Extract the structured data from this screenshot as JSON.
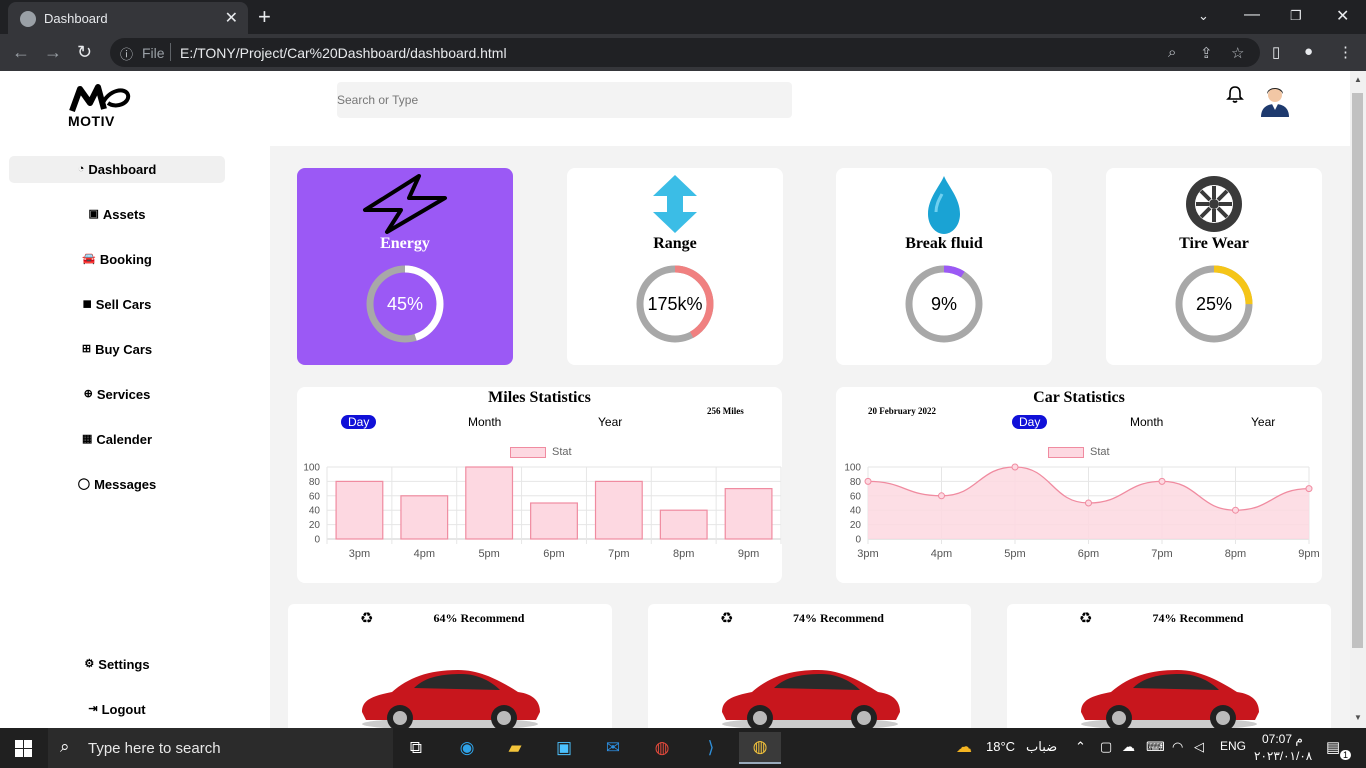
{
  "browser": {
    "tab_title": "Dashboard",
    "file_label": "File",
    "url": "E:/TONY/Project/Car%20Dashboard/dashboard.html"
  },
  "header": {
    "logo_text": "MOTIV",
    "search_placeholder": "Search or Type"
  },
  "sidebar": {
    "items": [
      {
        "label": "Dashboard",
        "icon": "dashboard-icon",
        "active": true
      },
      {
        "label": "Assets",
        "icon": "image-icon"
      },
      {
        "label": "Booking",
        "icon": "car-icon"
      },
      {
        "label": "Sell Cars",
        "icon": "bag-icon"
      },
      {
        "label": "Buy Cars",
        "icon": "cart-icon"
      },
      {
        "label": "Services",
        "icon": "lifebuoy-icon"
      },
      {
        "label": "Calender",
        "icon": "calendar-icon"
      },
      {
        "label": "Messages",
        "icon": "comment-icon"
      }
    ],
    "bottom": [
      {
        "label": "Settings",
        "icon": "gear-icon"
      },
      {
        "label": "Logout",
        "icon": "logout-icon"
      }
    ]
  },
  "stats": [
    {
      "label": "Energy",
      "value": "45%",
      "fraction": 0.45,
      "icon": "lightning-icon",
      "ring_color": "#ffffff"
    },
    {
      "label": "Range",
      "value": "175k%",
      "fraction": 0.42,
      "icon": "vertical-arrows-icon",
      "ring_color": "#f08080"
    },
    {
      "label": "Break fluid",
      "value": "9%",
      "fraction": 0.09,
      "icon": "droplet-icon",
      "ring_color": "#9b59f5"
    },
    {
      "label": "Tire Wear",
      "value": "25%",
      "fraction": 0.25,
      "icon": "tire-icon",
      "ring_color": "#f5c518"
    }
  ],
  "miles": {
    "title": "Miles Statistics",
    "note": "256 Miles",
    "periods": [
      "Day",
      "Month",
      "Year"
    ],
    "legend": "Stat"
  },
  "car": {
    "title": "Car Statistics",
    "note": "20 February 2022",
    "periods": [
      "Day",
      "Month",
      "Year"
    ],
    "legend": "Stat"
  },
  "chart_data": [
    {
      "type": "bar",
      "title": "Miles Statistics",
      "categories": [
        "3pm",
        "4pm",
        "5pm",
        "6pm",
        "7pm",
        "8pm",
        "9pm"
      ],
      "series": [
        {
          "name": "Stat",
          "values": [
            80,
            60,
            100,
            50,
            80,
            40,
            70
          ]
        }
      ],
      "ylim": [
        0,
        100
      ],
      "yticks": [
        "0",
        "20",
        "40",
        "60",
        "80",
        "100"
      ],
      "grid": true,
      "legend": "top"
    },
    {
      "type": "area",
      "title": "Car Statistics",
      "categories": [
        "3pm",
        "4pm",
        "5pm",
        "6pm",
        "7pm",
        "8pm",
        "9pm"
      ],
      "series": [
        {
          "name": "Stat",
          "values": [
            80,
            60,
            100,
            50,
            80,
            40,
            70
          ]
        }
      ],
      "ylim": [
        0,
        100
      ],
      "yticks": [
        "0",
        "20",
        "40",
        "60",
        "80",
        "100"
      ],
      "grid": true,
      "legend": "top"
    }
  ],
  "recommend": [
    {
      "text": "64% Recommend",
      "icon": "recycle-icon"
    },
    {
      "text": "74% Recommend",
      "icon": "recycle-icon"
    },
    {
      "text": "74% Recommend",
      "icon": "recycle-icon"
    }
  ],
  "taskbar": {
    "search_placeholder": "Type here to search",
    "weather_temp": "18°C",
    "weather_desc": "ضباب",
    "lang": "ENG",
    "time": "07:07 م",
    "date": "٢٠٢٣/٠١/٠٨",
    "notif_count": "1"
  },
  "colors": {
    "accent_purple": "#9b59f5",
    "active_period": "#1010d8",
    "chart_fill": "#fdd8e1",
    "chart_stroke": "#f08ba0"
  }
}
